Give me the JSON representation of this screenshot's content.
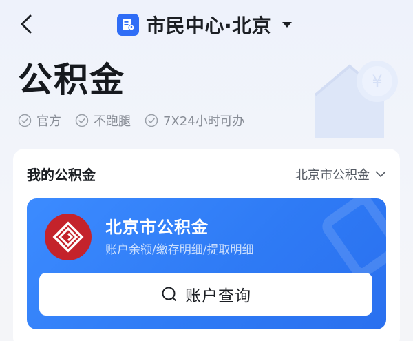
{
  "header": {
    "title": "市民中心·北京",
    "icons": {
      "back": "chevron-left-icon",
      "app": "citizen-center-icon",
      "caret": "caret-down-icon"
    }
  },
  "hero": {
    "title": "公积金",
    "badges": [
      {
        "label": "官方"
      },
      {
        "label": "不跑腿"
      },
      {
        "label": "7X24小时可办"
      }
    ]
  },
  "card": {
    "title": "我的公积金",
    "selector_label": "北京市公积金",
    "fund": {
      "name": "北京市公积金",
      "description": "账户余额/缴存明细/提取明细",
      "action_label": "账户查询"
    }
  },
  "colors": {
    "accent": "#2f7bf5",
    "logo_red": "#c4232b",
    "muted_text": "#888d96"
  }
}
